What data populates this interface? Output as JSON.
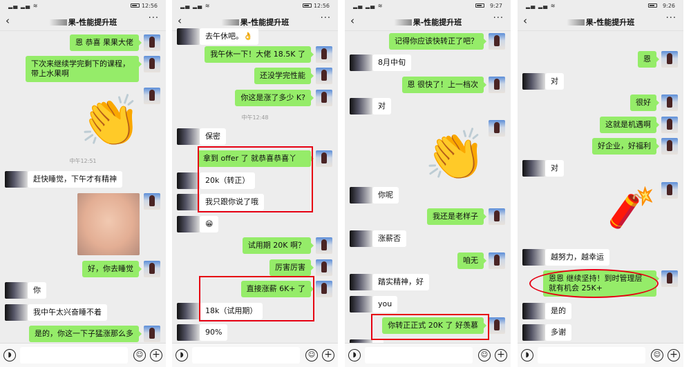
{
  "accent": "#95ec69",
  "highlight_color": "#e60012",
  "panels": [
    {
      "status_time": "12:56",
      "title": "果-性能提升班",
      "messages": [
        {
          "side": "self",
          "text": "恩 恭喜 果果大佬"
        },
        {
          "side": "self",
          "text": "下次来继续学完剩下的课程，带上水果啊"
        },
        {
          "side": "self",
          "type": "sticker",
          "icon": "clapping-hands-icon"
        },
        {
          "type": "time",
          "text": "中午12:51"
        },
        {
          "side": "other",
          "text": "赶快睡觉，下午才有精神"
        },
        {
          "side": "self",
          "type": "image",
          "icon": "baby-photo"
        },
        {
          "side": "self",
          "text": "好，你去睡觉"
        },
        {
          "side": "other",
          "text": "你"
        },
        {
          "side": "other",
          "text": "我中午太兴奋睡不着"
        },
        {
          "side": "self",
          "text": "是的，你这一下子猛涨那么多"
        }
      ]
    },
    {
      "status_time": "12:56",
      "title": "果-性能提升班",
      "messages": [
        {
          "side": "other",
          "text": "去午休吧。👌"
        },
        {
          "side": "self",
          "text": "我午休一下！大佬 18.5K 了"
        },
        {
          "side": "self",
          "text": "还没学完性能"
        },
        {
          "side": "self",
          "text": "你这是涨了多少 K?"
        },
        {
          "type": "time",
          "text": "中午12:48"
        },
        {
          "side": "other",
          "text": "保密"
        },
        {
          "side": "self",
          "text": "拿到 offer 了 就恭喜恭喜丫"
        },
        {
          "side": "other",
          "text": "20k（转正）"
        },
        {
          "side": "other",
          "text": "我只跟你说了哦"
        },
        {
          "side": "other",
          "text": "😁"
        },
        {
          "side": "self",
          "text": "试用期 20K 啊？"
        },
        {
          "side": "self",
          "text": "厉害厉害"
        },
        {
          "side": "self",
          "text": "直接涨薪 6K+ 了"
        },
        {
          "side": "other",
          "text": "18k（试用期）"
        },
        {
          "side": "other",
          "text": "90%"
        }
      ]
    },
    {
      "status_time": "9:27",
      "title": "果-性能提升班",
      "messages": [
        {
          "side": "self",
          "text": "记得你应该快转正了吧？"
        },
        {
          "side": "other",
          "text": "8月中旬"
        },
        {
          "side": "self",
          "text": "恩 很快了！上一档次"
        },
        {
          "side": "other",
          "text": "对"
        },
        {
          "side": "self",
          "type": "sticker",
          "icon": "clapping-hands-icon"
        },
        {
          "side": "other",
          "text": "你呢"
        },
        {
          "side": "self",
          "text": "我还是老样子"
        },
        {
          "side": "other",
          "text": "涨薪否"
        },
        {
          "side": "self",
          "text": "咱无"
        },
        {
          "side": "other",
          "text": "踏实精神，好"
        },
        {
          "side": "other",
          "text": "you"
        },
        {
          "side": "self",
          "text": "你转正正式 20K 了 好羡慕"
        },
        {
          "side": "other",
          "text": ""
        }
      ]
    },
    {
      "status_time": "9:26",
      "title": "果-性能提升班",
      "messages": [
        {
          "side": "self",
          "text": "恩"
        },
        {
          "side": "other",
          "text": "对"
        },
        {
          "side": "self",
          "text": "很好"
        },
        {
          "side": "self",
          "text": "这就是机遇啊"
        },
        {
          "side": "self",
          "text": "好企业，好福利"
        },
        {
          "side": "other",
          "text": "对"
        },
        {
          "side": "self",
          "type": "sticker",
          "icon": "firecracker-icon"
        },
        {
          "side": "other",
          "text": "越努力，越幸运"
        },
        {
          "side": "self",
          "text": "恩恩 继续坚持！到时管理层 就有机会 25K+"
        },
        {
          "side": "other",
          "text": "是的"
        },
        {
          "side": "other",
          "text": "多谢"
        }
      ]
    }
  ],
  "input": {
    "voice_icon": "voice-icon",
    "emoji_icon": "emoji-icon",
    "plus_icon": "plus-icon"
  }
}
